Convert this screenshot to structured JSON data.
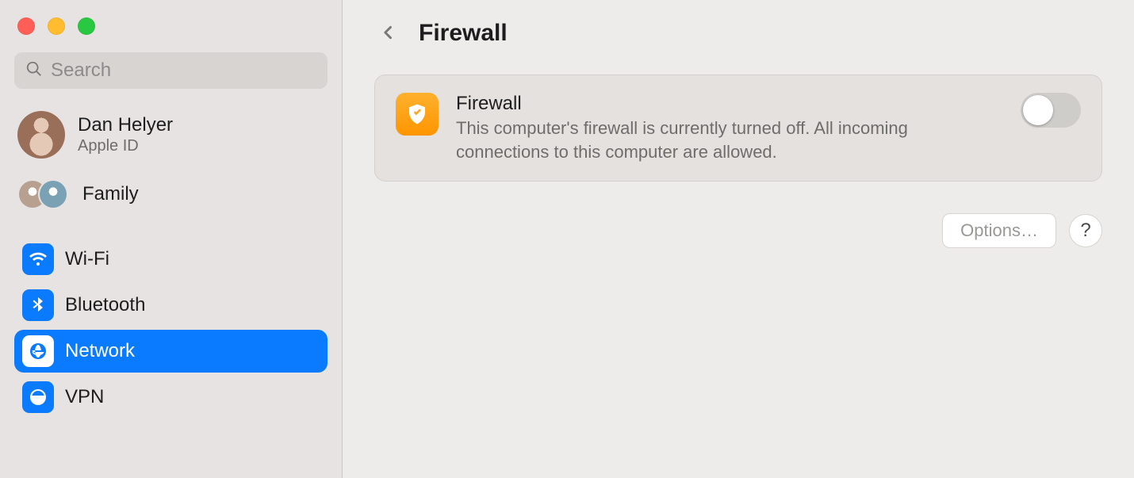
{
  "search": {
    "placeholder": "Search"
  },
  "account": {
    "name": "Dan Helyer",
    "subtitle": "Apple ID",
    "family_label": "Family"
  },
  "sidebar": {
    "items": [
      {
        "label": "Wi-Fi"
      },
      {
        "label": "Bluetooth"
      },
      {
        "label": "Network"
      },
      {
        "label": "VPN"
      }
    ]
  },
  "header": {
    "title": "Firewall"
  },
  "firewall_card": {
    "title": "Firewall",
    "description": "This computer's firewall is currently turned off. All incoming connections to this computer are allowed.",
    "enabled": false
  },
  "footer": {
    "options_label": "Options…",
    "help_label": "?"
  }
}
